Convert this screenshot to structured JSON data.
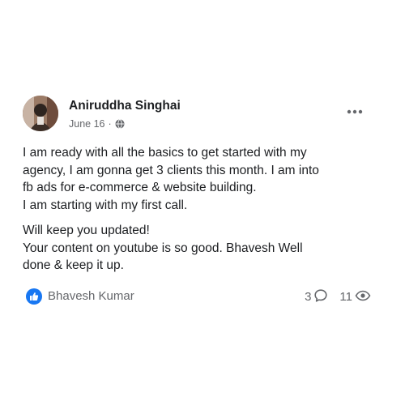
{
  "post": {
    "author": "Aniruddha Singhai",
    "date": "June 16",
    "separator": "·",
    "audience_icon": "globe-icon",
    "more_icon": "more-options-icon",
    "paragraphs": [
      [
        "I am ready with all the basics to get started with my",
        "agency, I am gonna get 3 clients this month. I am into",
        "fb ads for e-commerce & website building.",
        "I am starting with my first call."
      ],
      [
        "Will keep you updated!",
        "Your content on youtube is so good. Bhavesh Well",
        "done & keep it up."
      ]
    ],
    "reaction": {
      "icon": "like-icon",
      "reactor": "Bhavesh Kumar"
    },
    "stats": {
      "comments": "3",
      "comment_icon": "comment-icon",
      "views": "11",
      "view_icon": "eye-icon"
    }
  },
  "colors": {
    "primary_text": "#1c1e21",
    "secondary_text": "#65676b",
    "like_blue": "#1877f2"
  }
}
